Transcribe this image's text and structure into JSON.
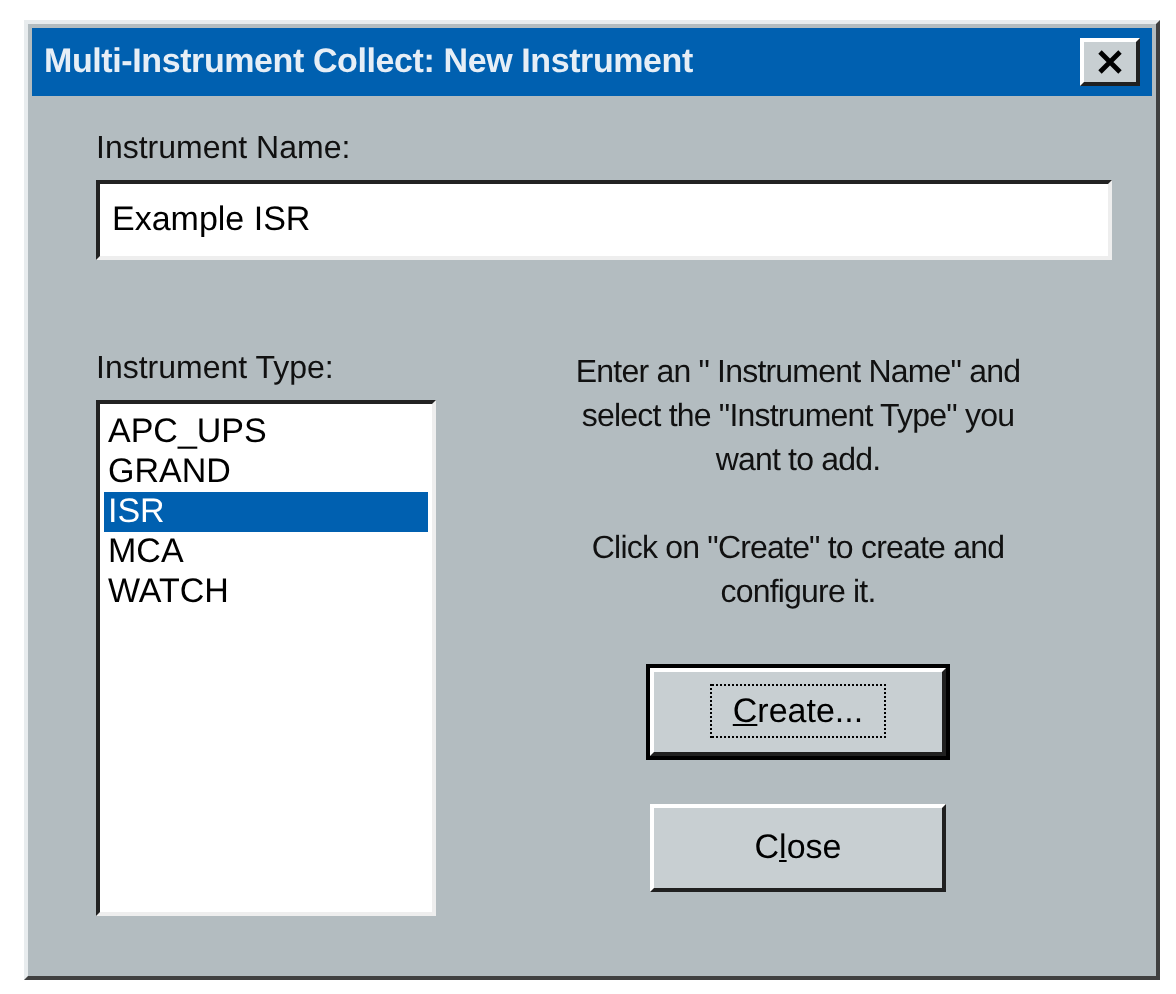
{
  "window": {
    "title": "Multi-Instrument Collect: New Instrument"
  },
  "name_field": {
    "label": "Instrument Name:",
    "value": "Example ISR"
  },
  "type_list": {
    "label": "Instrument Type:",
    "items": [
      {
        "label": "APC_UPS",
        "selected": false
      },
      {
        "label": "GRAND",
        "selected": false
      },
      {
        "label": "ISR",
        "selected": true
      },
      {
        "label": "MCA",
        "selected": false
      },
      {
        "label": "WATCH",
        "selected": false
      }
    ]
  },
  "instructions": [
    "Enter an \" Instrument Name\" and select the \"Instrument Type\" you want to add.",
    "Click on \"Create\" to create and configure it."
  ],
  "buttons": [
    {
      "key": "C",
      "post": "reate...",
      "default": true,
      "focused": true
    },
    {
      "pre": "C",
      "key": "l",
      "post": "ose",
      "default": false,
      "focused": false
    }
  ]
}
